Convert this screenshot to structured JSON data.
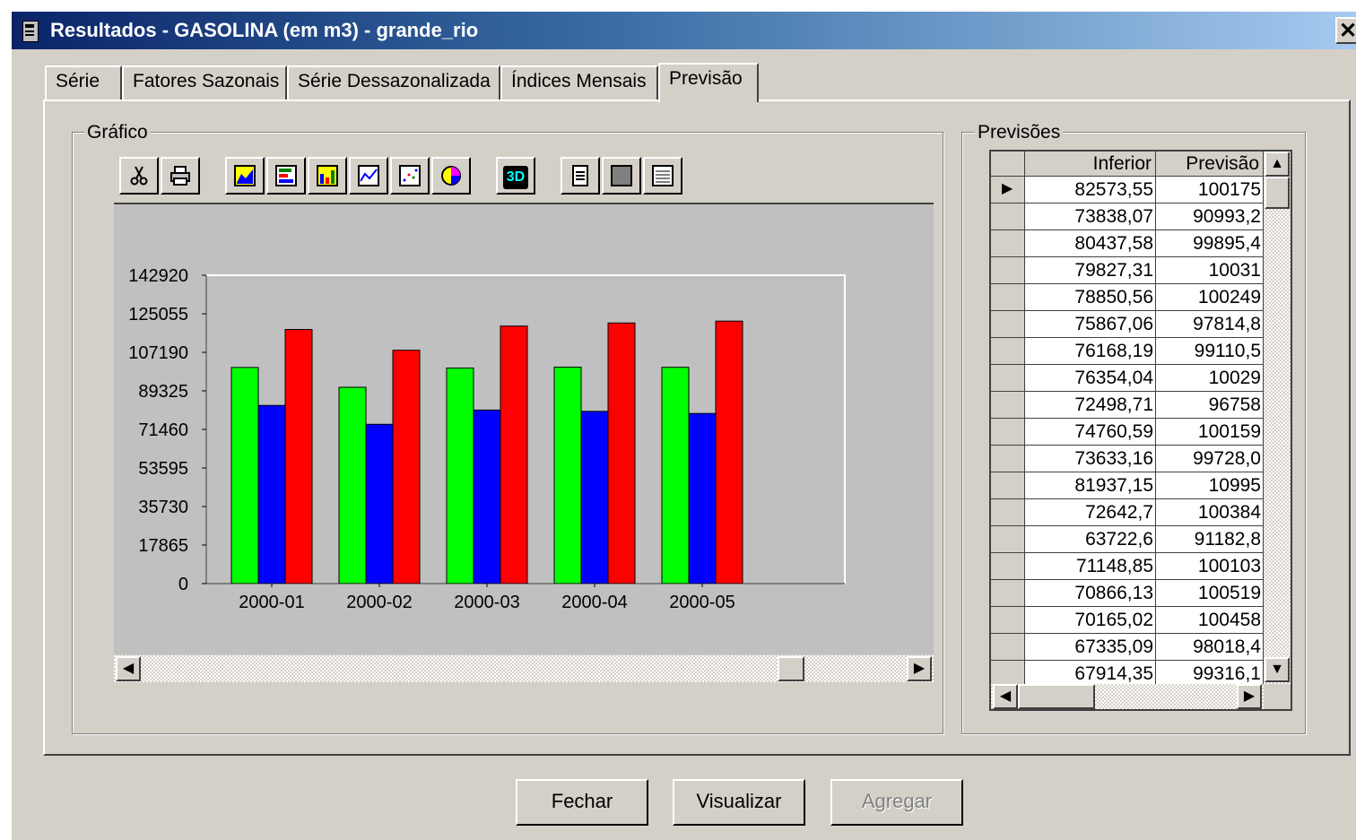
{
  "window": {
    "title": "Resultados - GASOLINA (em m3) - grande_rio",
    "close": "✕"
  },
  "tabs": [
    {
      "label": "Série",
      "active": false
    },
    {
      "label": "Fatores Sazonais",
      "active": false
    },
    {
      "label": "Série Dessazonalizada",
      "active": false
    },
    {
      "label": "Índices Mensais",
      "active": false
    },
    {
      "label": "Previsão",
      "active": true
    }
  ],
  "chart_group": {
    "label": "Gráfico"
  },
  "forecast_group": {
    "label": "Previsões"
  },
  "toolbar": [
    {
      "icon": "cut-icon"
    },
    {
      "icon": "print-icon"
    },
    {
      "icon": "area-chart-icon"
    },
    {
      "icon": "horizontal-bar-chart-icon"
    },
    {
      "icon": "bar-chart-icon"
    },
    {
      "icon": "line-chart-icon"
    },
    {
      "icon": "scatter-chart-icon"
    },
    {
      "icon": "pie-chart-icon"
    },
    {
      "icon": "3d-toggle-icon",
      "label": "3D"
    },
    {
      "icon": "copy-icon"
    },
    {
      "icon": "background-color-icon"
    },
    {
      "icon": "gridlines-icon"
    }
  ],
  "chart_data": {
    "type": "bar",
    "categories": [
      "2000-01",
      "2000-02",
      "2000-03",
      "2000-04",
      "2000-05"
    ],
    "series": [
      {
        "color": "#00ff00",
        "values": [
          100175,
          90993,
          99895,
          100310,
          100249
        ]
      },
      {
        "color": "#0000ff",
        "values": [
          82573.55,
          73838.07,
          80437.58,
          79827.31,
          78850.56
        ]
      },
      {
        "color": "#ff0000",
        "values": [
          117776,
          108148,
          119353,
          120793,
          121647
        ]
      }
    ],
    "yticks": [
      "142920",
      "125055",
      "107190",
      "89325",
      "71460",
      "53595",
      "35730",
      "17865",
      "0"
    ],
    "ylim": [
      0,
      142920
    ],
    "grid": false,
    "legend": "none"
  },
  "grid": {
    "columns": [
      "Inferior",
      "Previsão"
    ],
    "rows": [
      [
        "82573,55",
        "100175"
      ],
      [
        "73838,07",
        "90993,2"
      ],
      [
        "80437,58",
        "99895,4"
      ],
      [
        "79827,31",
        "10031"
      ],
      [
        "78850,56",
        "100249"
      ],
      [
        "75867,06",
        "97814,8"
      ],
      [
        "76168,19",
        "99110,5"
      ],
      [
        "76354,04",
        "10029"
      ],
      [
        "72498,71",
        "96758"
      ],
      [
        "74760,59",
        "100159"
      ],
      [
        "73633,16",
        "99728,0"
      ],
      [
        "81937,15",
        "10995"
      ],
      [
        "72642,7",
        "100384"
      ],
      [
        "63722,6",
        "91182,8"
      ],
      [
        "71148,85",
        "100103"
      ],
      [
        "70866,13",
        "100519"
      ],
      [
        "70165,02",
        "100458"
      ],
      [
        "67335,09",
        "98018,4"
      ],
      [
        "67914,35",
        "99316,1"
      ]
    ],
    "current_row": 0
  },
  "buttons": {
    "close": "Fechar",
    "view": "Visualizar",
    "add": "Agregar"
  }
}
